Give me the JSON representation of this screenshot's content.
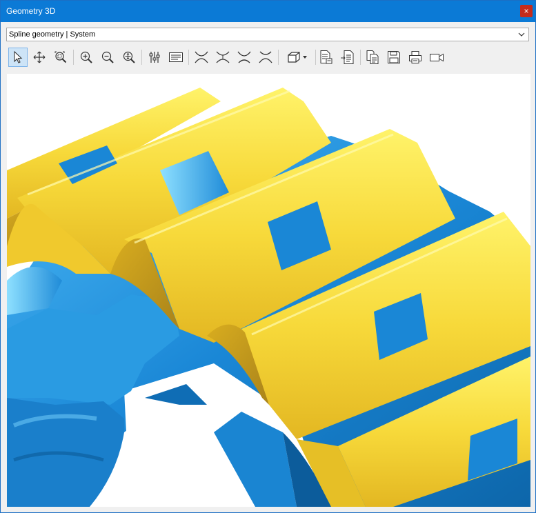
{
  "window": {
    "title": "Geometry 3D",
    "close_glyph": "×"
  },
  "selector": {
    "value": "Spline geometry | System"
  },
  "toolbar": {
    "buttons": [
      {
        "name": "select-pointer-button",
        "icon": "cursor-arrow-icon"
      },
      {
        "name": "pan-button",
        "icon": "move-arrows-icon"
      },
      {
        "name": "zoom-window-button",
        "icon": "zoom-window-icon"
      },
      {
        "name": "zoom-in-button",
        "icon": "zoom-in-icon"
      },
      {
        "name": "zoom-out-button",
        "icon": "zoom-out-icon"
      },
      {
        "name": "zoom-fit-button",
        "icon": "zoom-fit-icon"
      },
      {
        "name": "settings-sliders-button",
        "icon": "sliders-icon"
      },
      {
        "name": "text-legend-button",
        "icon": "text-lines-icon"
      },
      {
        "name": "view-1-button",
        "icon": "curve-view-icon"
      },
      {
        "name": "view-2-button",
        "icon": "curve-view-icon"
      },
      {
        "name": "view-3-button",
        "icon": "curve-view-icon"
      },
      {
        "name": "view-4-button",
        "icon": "curve-view-icon"
      },
      {
        "name": "view-cube-dropdown-button",
        "icon": "cube-icon"
      },
      {
        "name": "report-button",
        "icon": "document-icon"
      },
      {
        "name": "export-button",
        "icon": "document-export-icon"
      },
      {
        "name": "copy-button",
        "icon": "copy-icon"
      },
      {
        "name": "save-button",
        "icon": "floppy-disk-icon"
      },
      {
        "name": "print-button",
        "icon": "printer-icon"
      },
      {
        "name": "record-video-button",
        "icon": "video-camera-icon"
      }
    ]
  },
  "colors": {
    "accent": "#0b7ad6",
    "gear_yellow": "#f5d53a",
    "gear_blue": "#1a87d6"
  }
}
